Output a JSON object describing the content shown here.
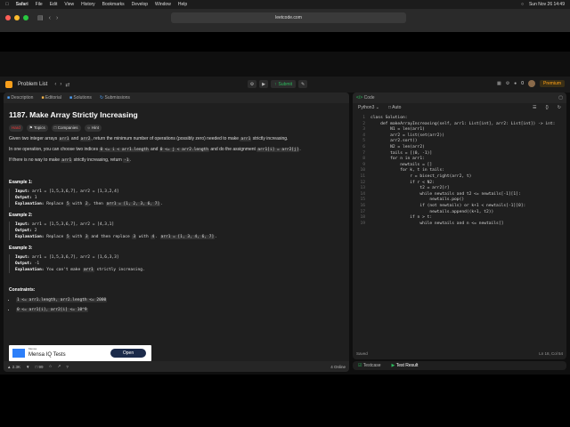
{
  "mac_menu": {
    "items": [
      "Safari",
      "File",
      "Edit",
      "View",
      "History",
      "Bookmarks",
      "Develop",
      "Window",
      "Help"
    ],
    "datetime": "Sun Nov 26 14:49"
  },
  "browser": {
    "url": "leetcode.com"
  },
  "leetcode": {
    "problem_list": "Problem List",
    "submit": "Submit",
    "premium": "Premium",
    "counter": "0"
  },
  "left_tabs": [
    "Description",
    "Editorial",
    "Solutions",
    "Submissions"
  ],
  "problem": {
    "title": "1187. Make Array Strictly Increasing",
    "tags": [
      "Hard",
      "Topics",
      "Companies",
      "Hint"
    ],
    "desc1_a": "Given two integer arrays",
    "desc1_code1": "arr1",
    "desc1_b": "and",
    "desc1_code2": "arr2",
    "desc1_c": ", return the minimum number of operations (possibly zero) needed to make",
    "desc1_code3": "arr1",
    "desc1_d": "strictly increasing.",
    "desc2_a": "In one operation, you can choose two indices",
    "desc2_code1": "0 <= i < arr1.length",
    "desc2_b": "and",
    "desc2_code2": "0 <= j < arr2.length",
    "desc2_c": "and do the assignment",
    "desc2_code3": "arr1[i] = arr2[j]",
    "desc2_d": ".",
    "desc3_a": "If there is no way to make",
    "desc3_code1": "arr1",
    "desc3_b": "strictly increasing, return",
    "desc3_code2": "-1",
    "desc3_c": "."
  },
  "examples": [
    {
      "heading": "Example 1:",
      "input": "arr1 = [1,5,3,6,7], arr2 = [1,3,2,4]",
      "output": "1",
      "explanation_a": "Replace",
      "explanation_code1": "5",
      "explanation_b": "with",
      "explanation_code2": "2",
      "explanation_c": ", then",
      "explanation_code3": "arr1 = [1, 2, 3, 6, 7]",
      "explanation_d": "."
    },
    {
      "heading": "Example 2:",
      "input": "arr1 = [1,5,3,6,7], arr2 = [4,3,1]",
      "output": "2",
      "explanation_a": "Replace",
      "explanation_code1": "5",
      "explanation_b": "with",
      "explanation_code2": "3",
      "explanation_c": "and then replace",
      "explanation_code3": "3",
      "explanation_d": "with",
      "explanation_code4": "4",
      "explanation_e": ".",
      "explanation_code5": "arr1 = [1, 3, 4, 6, 7]",
      "explanation_f": "."
    },
    {
      "heading": "Example 3:",
      "input": "arr1 = [1,5,3,6,7], arr2 = [1,6,3,3]",
      "output": "-1",
      "explanation_a": "You can't make",
      "explanation_code1": "arr1",
      "explanation_b": "strictly increasing."
    }
  ],
  "labels": {
    "input": "Input:",
    "output": "Output:",
    "explanation": "Explanation:"
  },
  "constraints": {
    "heading": "Constraints:",
    "items": [
      "1 <= arr1.length, arr2.length <= 2000",
      "0 <= arr1[i], arr2[i] <= 10^9"
    ]
  },
  "ad": {
    "brand": "Mensa",
    "title": "Mensa IQ Tests",
    "button": "Open"
  },
  "left_footer": {
    "likes": "2.3K",
    "comments": "99",
    "online": "4 Online"
  },
  "code_panel": {
    "tab": "Code",
    "language": "Python3",
    "auto": "Auto",
    "saved": "Saved",
    "position": "Ln 18, Col 54"
  },
  "code_lines": [
    "class Solution:",
    "    def makeArrayIncreasing(self, arr1: List[int], arr2: List[int]) -> int:",
    "        N1 = len(arr1)",
    "        arr2 = list(set(arr2))",
    "        arr2.sort()",
    "        N2 = len(arr2)",
    "        tails = [(0, -1)]",
    "        for n in arr1:",
    "            newtails = []",
    "            for k, t in tails:",
    "                r = bisect_right(arr2, t)",
    "                if r < N2:",
    "                    t2 = arr2[r]",
    "                    while newtails and t2 <= newtails[-1][1]:",
    "                        newtails.pop()",
    "                    if (not newtails) or k+1 < newtails[-1][0]:",
    "                        newtails.append((k+1, t2))",
    "                if n > t:",
    "                    while newtails and n <= newtails[]"
  ],
  "bottom_tabs": [
    "Testcase",
    "Test Result"
  ]
}
